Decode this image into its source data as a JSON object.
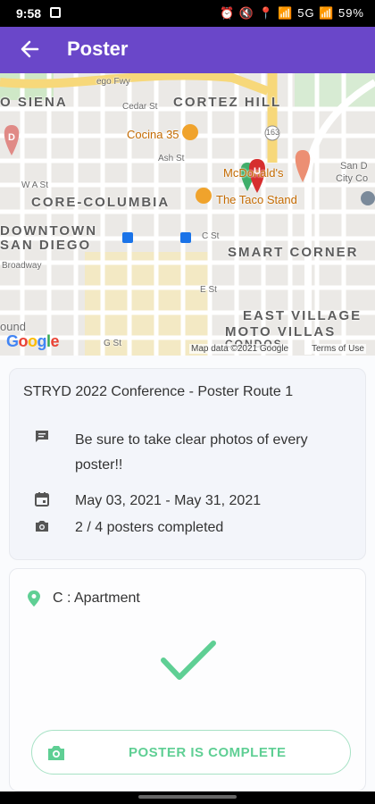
{
  "status_bar": {
    "time": "9:58",
    "right": "⏰ 🔇 📍 📶 5G 📶 59%"
  },
  "app_bar": {
    "title": "Poster",
    "back_icon": "arrow-left-icon"
  },
  "map": {
    "labels": {
      "siena": "O SIENA",
      "cortez": "CORTEZ HILL",
      "core": "CORE-COLUMBIA",
      "downtown": "DOWNTOWN",
      "sandiego": "SAN DIEGO",
      "smart": "SMART CORNER",
      "east": "EAST VILLAGE",
      "moto": "MOTO VILLAS",
      "condos": "CONDOS",
      "cedar": "Cedar St",
      "ash": "Ash St",
      "wast": "W A St",
      "broadway": "Broadway",
      "cst": "C St",
      "est": "E St",
      "gst": "G St",
      "fwy": "ego Fwy",
      "ound": "ound",
      "city": "San D",
      "city2": "City Co",
      "cocina": "Cocina 35",
      "taco": "The Taco Stand",
      "mcd": "McDonald's",
      "pin_d": "D",
      "pin_u": "U",
      "route": "163"
    },
    "google": "Google",
    "attribution": "Map data ©2021 Google",
    "terms": "Terms of Use"
  },
  "route_card": {
    "title": "STRYD 2022 Conference - Poster Route 1",
    "note_line1": "Be sure to take clear photos of every",
    "note_line2": "poster!!",
    "dates": "May 03, 2021 - May 31, 2021",
    "progress": "2 / 4 posters completed",
    "progress_completed": 2,
    "progress_total": 4
  },
  "poster_card": {
    "location": "C : Apartment",
    "button_label": "POSTER IS COMPLETE"
  },
  "colors": {
    "primary": "#6a47c9",
    "success": "#5fcf94",
    "pin_red": "#d62e2e",
    "pin_orange": "#f0a32c"
  }
}
